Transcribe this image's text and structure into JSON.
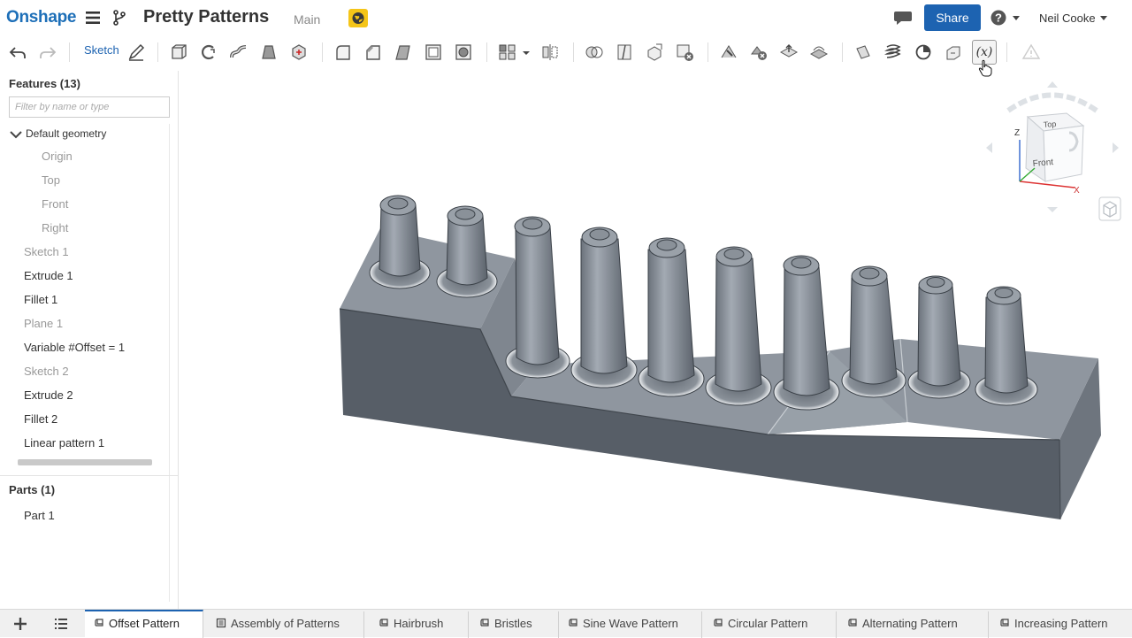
{
  "header": {
    "logo": "Onshape",
    "doc_title": "Pretty Patterns",
    "branch": "Main",
    "share_label": "Share",
    "user": "Neil Cooke"
  },
  "toolbar": {
    "sketch_label": "Sketch",
    "variable_label": "(x)"
  },
  "features": {
    "heading": "Features (13)",
    "filter_placeholder": "Filter by name or type",
    "default_geometry": "Default geometry",
    "items": [
      {
        "label": "Origin"
      },
      {
        "label": "Top"
      },
      {
        "label": "Front"
      },
      {
        "label": "Right"
      },
      {
        "label": "Sketch 1"
      },
      {
        "label": "Extrude 1"
      },
      {
        "label": "Fillet 1"
      },
      {
        "label": "Plane 1"
      },
      {
        "label": "Variable #Offset = 1"
      },
      {
        "label": "Sketch 2"
      },
      {
        "label": "Extrude 2"
      },
      {
        "label": "Fillet 2"
      },
      {
        "label": "Linear pattern 1"
      }
    ]
  },
  "parts": {
    "heading": "Parts (1)",
    "items": [
      {
        "label": "Part 1"
      }
    ]
  },
  "viewcube": {
    "top": "Top",
    "front": "Front",
    "axis_z": "Z",
    "axis_x": "X"
  },
  "tabs": [
    {
      "label": "Offset Pattern",
      "icon": "part-studio-icon"
    },
    {
      "label": "Assembly of Patterns",
      "icon": "assembly-icon"
    },
    {
      "label": "Hairbrush",
      "icon": "part-studio-icon"
    },
    {
      "label": "Bristles",
      "icon": "part-studio-icon"
    },
    {
      "label": "Sine Wave Pattern",
      "icon": "part-studio-icon"
    },
    {
      "label": "Circular Pattern",
      "icon": "part-studio-icon"
    },
    {
      "label": "Alternating Pattern",
      "icon": "part-studio-icon"
    },
    {
      "label": "Increasing Pattern",
      "icon": "part-studio-icon"
    }
  ],
  "colors": {
    "brand": "#1d6fb8",
    "share": "#1d63b1",
    "model_top": "#8e959e",
    "model_side": "#5b626b"
  }
}
